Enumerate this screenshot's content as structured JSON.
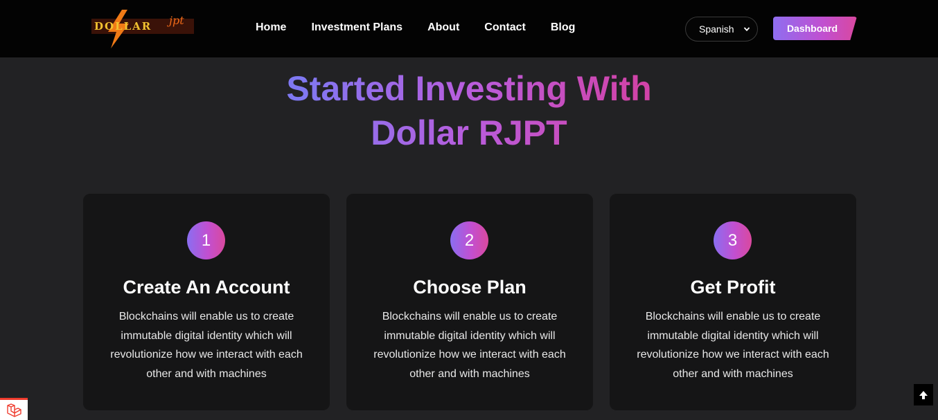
{
  "brand": {
    "logo_text": "DOLLAR",
    "logo_script": "jpt"
  },
  "nav": {
    "links": [
      "Home",
      "Investment Plans",
      "About",
      "Contact",
      "Blog"
    ]
  },
  "language": {
    "selected": "Spanish"
  },
  "dashboard": {
    "label": "Dashboard"
  },
  "hero": {
    "line1": "Started Investing With",
    "line2": "Dollar RJPT"
  },
  "steps": [
    {
      "number": "1",
      "title": "Create An Account",
      "description": "Blockchains will enable us to create immutable digital identity which will revolutionize how we interact with each other and with machines"
    },
    {
      "number": "2",
      "title": "Choose Plan",
      "description": "Blockchains will enable us to create immutable digital identity which will revolutionize how we interact with each other and with machines"
    },
    {
      "number": "3",
      "title": "Get Profit",
      "description": "Blockchains will enable us to create immutable digital identity which will revolutionize how we interact with each other and with machines"
    }
  ],
  "icons": {
    "scroll_top": "arrow-up-icon",
    "debug_badge": "laravel-icon",
    "select": "chevron-down-icon",
    "logo": "lightning-bolt-icon"
  },
  "colors": {
    "accent_start": "#8a6ef1",
    "accent_mid": "#c24fd0",
    "accent_end": "#d9499e",
    "background": "#222224",
    "card": "#151516",
    "nav": "#030303"
  }
}
